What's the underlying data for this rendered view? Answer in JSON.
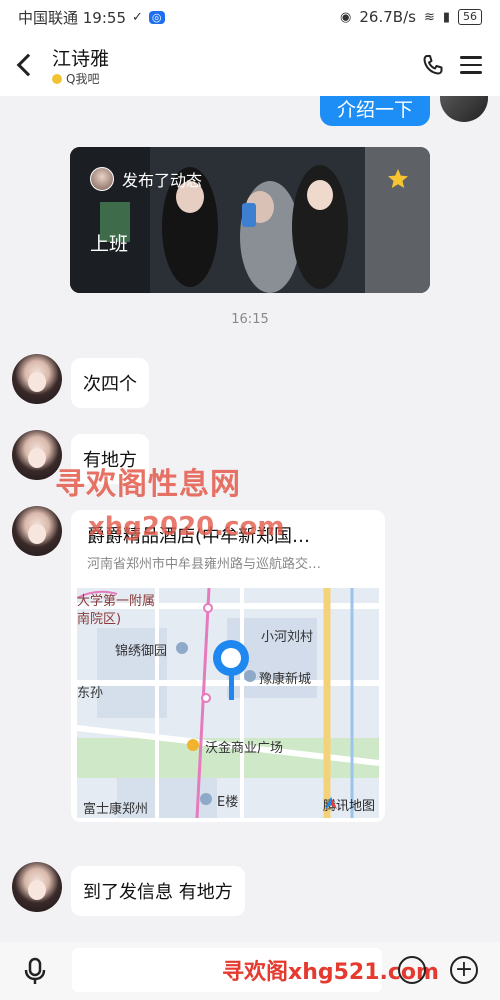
{
  "status_bar": {
    "carrier_time": "中国联通 19:55",
    "speed": "26.7B/s",
    "battery": "56"
  },
  "header": {
    "contact_name": "江诗雅",
    "contact_sub": "Q我吧",
    "back_icon": "chevron-left-icon",
    "phone_icon": "phone-icon",
    "menu_icon": "hamburger-menu-icon"
  },
  "messages": {
    "outgoing_top": "介绍一下",
    "moment": {
      "action": "发布了动态",
      "text": "上班"
    },
    "timestamp": "16:15",
    "incoming_1": "次四个",
    "incoming_2": "有地方",
    "location": {
      "title": "爵爵精品酒店(中牟新郑国…",
      "address": "河南省郑州市中牟县雍州路与巡航路交…",
      "labels": {
        "top_left_1": "大学第一附属",
        "top_left_2": "南院区)",
        "xiaohe": "小河刘村",
        "jinxiu": "锦绣御园",
        "yukang": "豫康新城",
        "dongsun": "东孙",
        "wojin": "沃金商业广场",
        "fushikang": "富士康郑州",
        "e_building": "E楼"
      },
      "map_provider": "腾讯地图"
    },
    "incoming_3": "到了发信息 有地方"
  },
  "watermarks": {
    "w1": "寻欢阁性息网",
    "w2": "xhg2020.com",
    "w3": "寻欢阁xhg521.com"
  },
  "input_bar": {
    "placeholder": ""
  },
  "colors": {
    "accent_blue": "#1e8ef7",
    "background": "#f2f2f5"
  }
}
